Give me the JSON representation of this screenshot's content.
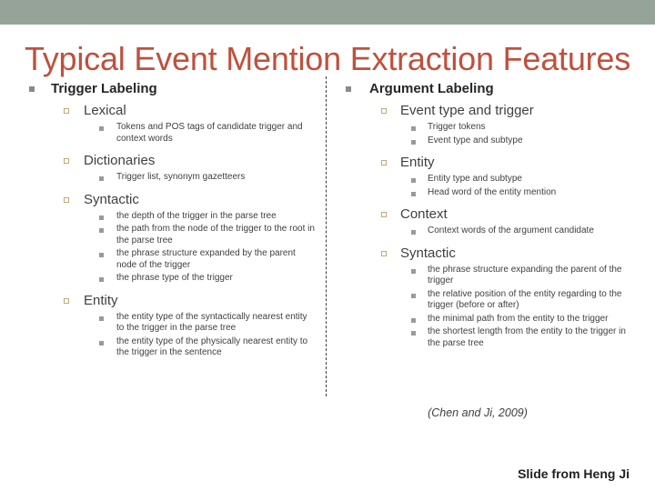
{
  "slide": {
    "title": "Typical Event Mention Extraction Features",
    "banner_color": "#95a399",
    "title_color": "#c0503c",
    "bullet_l1_color": "#8a8a8a",
    "bullet_l2_color": "#bfa97a",
    "bullet_l3_color": "#9a9a9a",
    "citation": "(Chen and Ji, 2009)",
    "credit": "Slide from Heng Ji"
  },
  "left_column": {
    "heading": "Trigger Labeling",
    "sections": [
      {
        "label": "Lexical",
        "items": [
          "Tokens and POS tags of candidate trigger and context words"
        ]
      },
      {
        "label": "Dictionaries",
        "items": [
          "Trigger list, synonym gazetteers"
        ]
      },
      {
        "label": "Syntactic",
        "items": [
          "the depth of the trigger in the parse tree",
          "the path from the node of the trigger to the root in the parse tree",
          "the phrase structure expanded by the parent node of the trigger",
          "the phrase type of the trigger"
        ]
      },
      {
        "label": "Entity",
        "items": [
          "the entity type of the syntactically nearest entity to the trigger in the parse tree",
          "the entity type of the physically nearest entity to the trigger in the sentence"
        ]
      }
    ]
  },
  "right_column": {
    "heading": "Argument Labeling",
    "sections": [
      {
        "label": "Event type and trigger",
        "items": [
          "Trigger tokens",
          "Event type and subtype"
        ]
      },
      {
        "label": "Entity",
        "items": [
          "Entity type and subtype",
          "Head word of the entity mention"
        ]
      },
      {
        "label": "Context",
        "items": [
          "Context words of the argument candidate"
        ]
      },
      {
        "label": "Syntactic",
        "items": [
          "the phrase structure expanding the parent of the trigger",
          "the relative position of the entity regarding to the trigger (before or after)",
          "the minimal path from the entity to the trigger",
          "the shortest length from the entity to the trigger in the parse tree"
        ]
      }
    ]
  }
}
